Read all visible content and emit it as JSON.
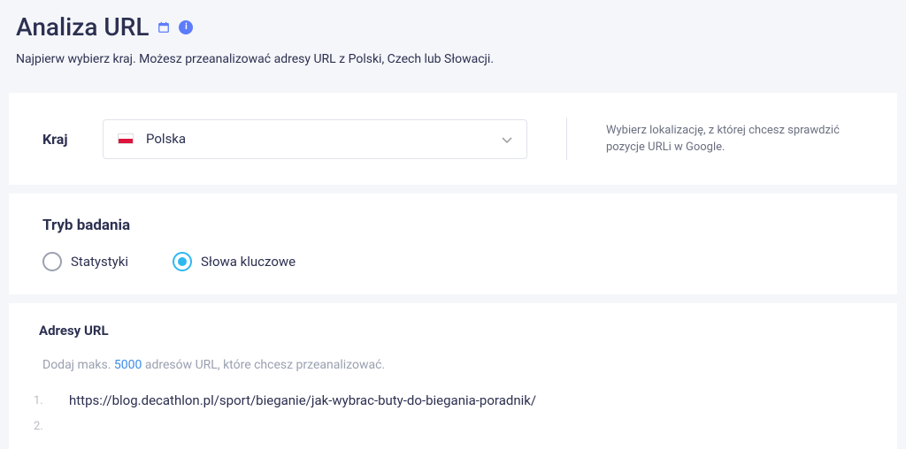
{
  "header": {
    "title": "Analiza URL",
    "subtitle": "Najpierw wybierz kraj. Możesz przeanalizować adresy URL z Polski, Czech lub Słowacji."
  },
  "country": {
    "label": "Kraj",
    "selected": "Polska",
    "help_text": "Wybierz lokalizację, z której chcesz sprawdzić pozycje URLi w Google."
  },
  "research_mode": {
    "title": "Tryb badania",
    "options": [
      {
        "label": "Statystyki",
        "selected": false
      },
      {
        "label": "Słowa kluczowe",
        "selected": true
      }
    ]
  },
  "urls": {
    "title": "Adresy URL",
    "hint_prefix": "Dodaj maks. ",
    "hint_max": "5000",
    "hint_suffix": " adresów URL, które chcesz przeanalizować.",
    "items": [
      {
        "number": "1.",
        "value": "https://blog.decathlon.pl/sport/bieganie/jak-wybrac-buty-do-biegania-poradnik/"
      },
      {
        "number": "2.",
        "value": ""
      }
    ]
  }
}
